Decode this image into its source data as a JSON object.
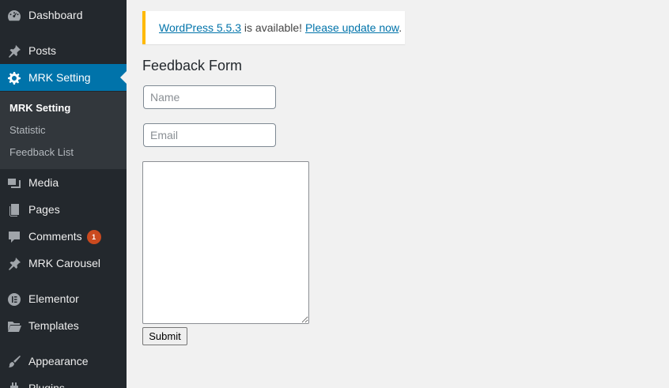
{
  "sidebar": {
    "items": [
      {
        "label": "Dashboard",
        "icon": "dashboard-icon"
      },
      {
        "label": "Posts",
        "icon": "pin-icon"
      },
      {
        "label": "MRK Setting",
        "icon": "gear-icon",
        "current": true
      },
      {
        "label": "Media",
        "icon": "media-icon"
      },
      {
        "label": "Pages",
        "icon": "pages-icon"
      },
      {
        "label": "Comments",
        "icon": "comment-icon",
        "badge": "1"
      },
      {
        "label": "MRK Carousel",
        "icon": "pin-icon"
      },
      {
        "label": "Elementor",
        "icon": "elementor-icon"
      },
      {
        "label": "Templates",
        "icon": "folder-icon"
      },
      {
        "label": "Appearance",
        "icon": "brush-icon"
      },
      {
        "label": "Plugins",
        "icon": "plugin-icon"
      }
    ],
    "submenu": [
      {
        "label": "MRK Setting",
        "active": true
      },
      {
        "label": "Statistic"
      },
      {
        "label": "Feedback List"
      }
    ]
  },
  "notice": {
    "link1": "WordPress 5.5.3",
    "middle": " is available! ",
    "link2": "Please update now",
    "end": "."
  },
  "form": {
    "title": "Feedback Form",
    "name_placeholder": "Name",
    "email_placeholder": "Email",
    "submit_label": "Submit"
  },
  "colors": {
    "sidebar_bg": "#23282d",
    "submenu_bg": "#32373c",
    "accent": "#0073aa",
    "notice_border": "#ffb900",
    "badge": "#ca4a1f"
  }
}
